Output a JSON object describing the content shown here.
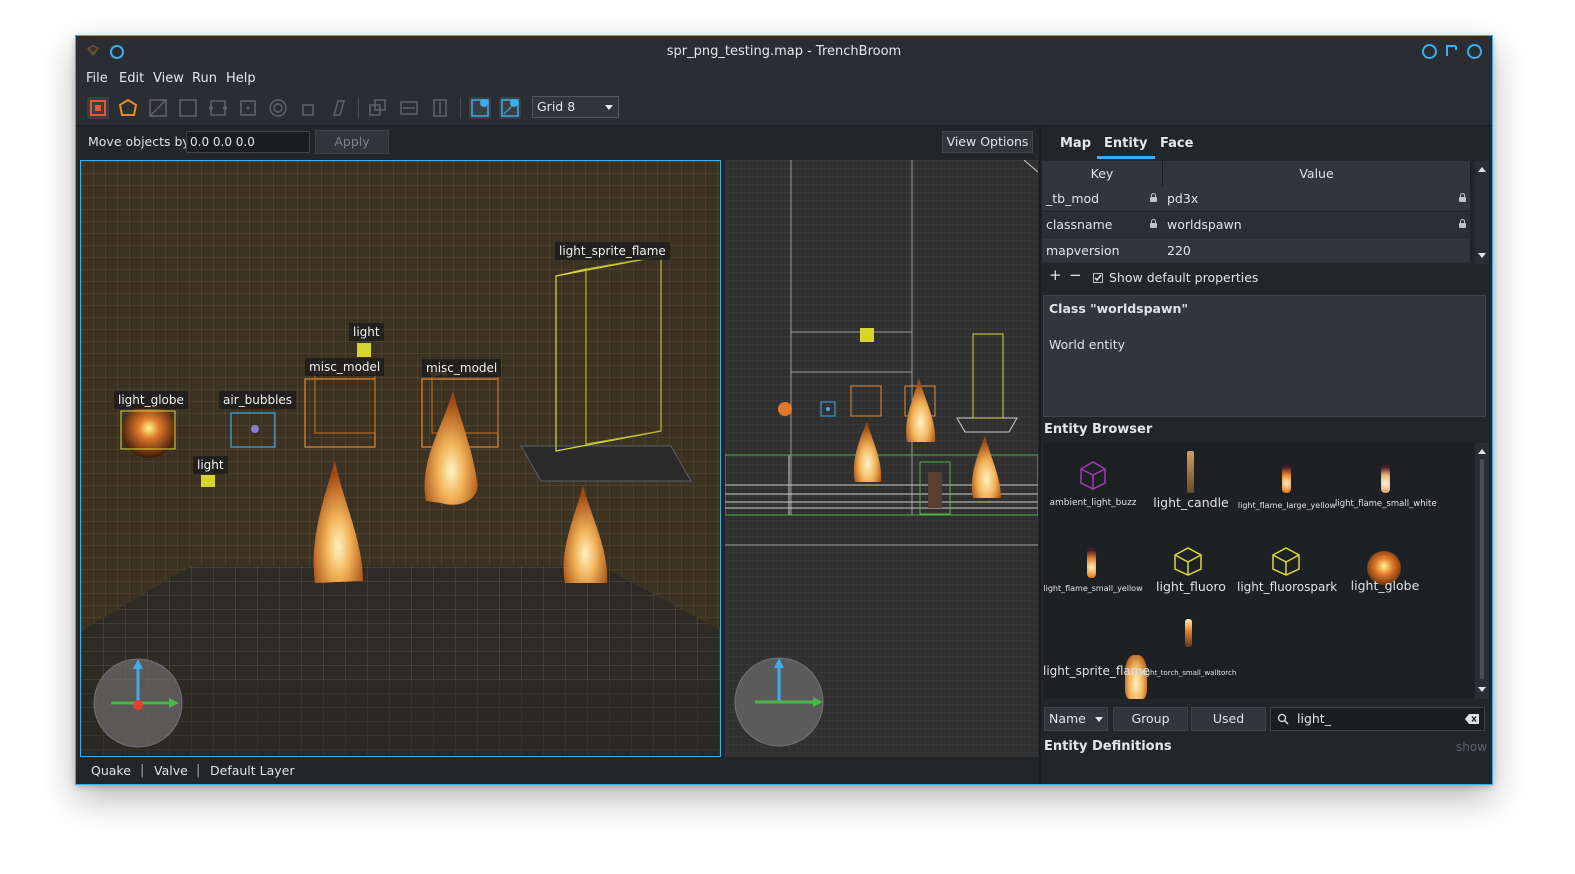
{
  "window": {
    "title": "spr_png_testing.map - TrenchBroom",
    "accent": "#3daee9"
  },
  "menu": [
    "File",
    "Edit",
    "View",
    "Run",
    "Help"
  ],
  "toolbar": {
    "tool_icons": [
      "move-tool-icon",
      "vertex-tool-icon",
      "edge-tool-icon",
      "face-tool-icon",
      "clip-tool-icon",
      "rotate-tool-icon",
      "scale-tool-icon",
      "shear-tool-icon",
      "duplicate-icon",
      "flip-h-icon",
      "flip-v-icon",
      "texture-lock-icon",
      "uv-lock-icon"
    ],
    "grid_select": "Grid 8"
  },
  "move_bar": {
    "label": "Move objects by",
    "value": "0.0 0.0 0.0",
    "apply": "Apply",
    "view_options": "View Options"
  },
  "viewport3d": {
    "labels": [
      "light_sprite_flame",
      "light",
      "misc_model",
      "misc_model",
      "light_globe",
      "air_bubbles",
      "light"
    ]
  },
  "status_bar": [
    "Quake",
    "Valve",
    "Default Layer"
  ],
  "inspector": {
    "tabs": [
      "Map",
      "Entity",
      "Face"
    ],
    "active_tab": "Entity",
    "columns": [
      "Key",
      "Value"
    ],
    "rows": [
      {
        "key": "_tb_mod",
        "value": "pd3x",
        "locked": true
      },
      {
        "key": "classname",
        "value": "worldspawn",
        "locked": true
      },
      {
        "key": "mapversion",
        "value": "220",
        "locked": false
      }
    ],
    "add": "+",
    "remove": "−",
    "show_default_label": "Show default properties",
    "show_default_checked": true,
    "class_title": "Class \"worldspawn\"",
    "class_desc": "World entity"
  },
  "entity_browser": {
    "title": "Entity Browser",
    "items": [
      "ambient_light_buzz",
      "light_candle",
      "light_flame_large_yellow",
      "light_flame_small_white",
      "light_flame_small_yellow",
      "light_fluoro",
      "light_fluorospark",
      "light_globe",
      "light_sprite_flame",
      "light_torch_small_walltorch"
    ],
    "sort": "Name",
    "group": "Group",
    "used": "Used",
    "filter": "light_"
  },
  "entity_definitions": {
    "title": "Entity Definitions",
    "toggle": "show"
  }
}
